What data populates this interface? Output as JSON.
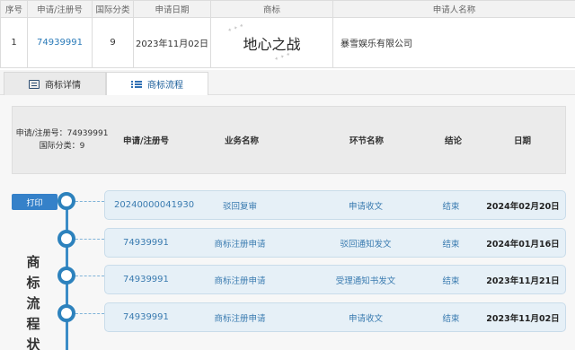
{
  "result_table": {
    "headers": [
      "序号",
      "申请/注册号",
      "国际分类",
      "申请日期",
      "商标",
      "申请人名称"
    ],
    "row": {
      "index": "1",
      "reg_no": "74939991",
      "class": "9",
      "apply_date": "2023年11月02日",
      "trademark": "地心之战",
      "applicant": "暴雪娱乐有限公司"
    }
  },
  "tabs": [
    {
      "label": "商标详情",
      "icon": "document-icon"
    },
    {
      "label": "商标流程",
      "icon": "list-icon"
    }
  ],
  "flow": {
    "info_reg": "申请/注册号：74939991",
    "info_class": "国际分类：9",
    "columns": [
      "申请/注册号",
      "业务名称",
      "环节名称",
      "结论",
      "日期"
    ],
    "print_label": "打印",
    "side_label": [
      "商",
      "标",
      "流",
      "程",
      "状"
    ],
    "rows": [
      {
        "reg_no": "20240000041930",
        "business": "驳回复审",
        "step": "申请收文",
        "result": "结束",
        "date": "2024年02月20日"
      },
      {
        "reg_no": "74939991",
        "business": "商标注册申请",
        "step": "驳回通知发文",
        "result": "结束",
        "date": "2024年01月16日"
      },
      {
        "reg_no": "74939991",
        "business": "商标注册申请",
        "step": "受理通知书发文",
        "result": "结束",
        "date": "2023年11月21日"
      },
      {
        "reg_no": "74939991",
        "business": "商标注册申请",
        "step": "申请收文",
        "result": "结束",
        "date": "2023年11月02日"
      }
    ]
  },
  "colors": {
    "accent": "#3581c9",
    "timeline": "#2d82bd",
    "card_bg": "#e6f0f7"
  }
}
